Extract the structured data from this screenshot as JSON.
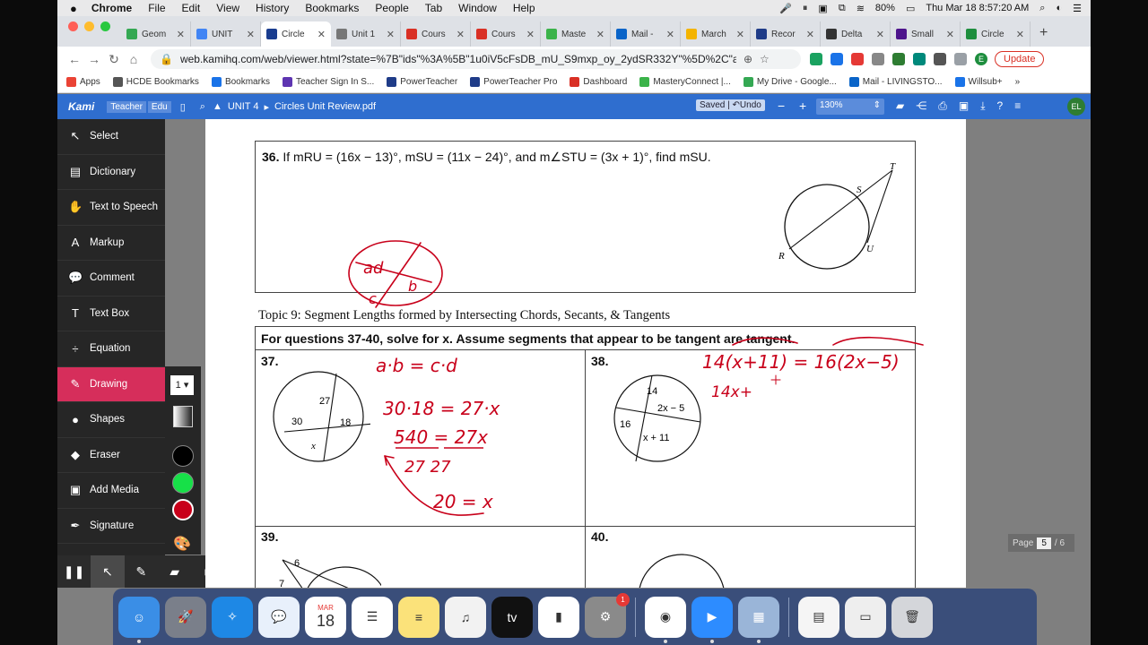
{
  "menubar": {
    "app_name": "Chrome",
    "items": [
      "File",
      "Edit",
      "View",
      "History",
      "Bookmarks",
      "People",
      "Tab",
      "Window",
      "Help"
    ],
    "battery": "80%",
    "datetime": "Thu Mar 18  8:57:20 AM"
  },
  "tabs": [
    {
      "label": "Geom",
      "color": "#34a853"
    },
    {
      "label": "UNIT",
      "color": "#4285f4"
    },
    {
      "label": "Circle",
      "color": "#1a3d8f",
      "active": true
    },
    {
      "label": "Unit 1",
      "color": "#777777"
    },
    {
      "label": "Cours",
      "color": "#d93025"
    },
    {
      "label": "Cours",
      "color": "#d93025"
    },
    {
      "label": "Maste",
      "color": "#3bb34a"
    },
    {
      "label": "Mail -",
      "color": "#0a64c8"
    },
    {
      "label": "March",
      "color": "#f4b400"
    },
    {
      "label": "Recor",
      "color": "#1f3c88"
    },
    {
      "label": "Delta",
      "color": "#333333"
    },
    {
      "label": "Small",
      "color": "#4d148c"
    },
    {
      "label": "Circle",
      "color": "#1e8e3e"
    }
  ],
  "address": {
    "url": "web.kamihq.com/web/viewer.html?state=%7B\"ids\"%3A%5B\"1u0iV5cFsDB_mU_S9mxp_oy_2ydSR332Y\"%5D%2C\"a...",
    "update_label": "Update",
    "profile": "E"
  },
  "bookmarks": [
    {
      "label": "Apps",
      "color": "#ea4335"
    },
    {
      "label": "HCDE Bookmarks",
      "color": "#555555"
    },
    {
      "label": "Bookmarks",
      "color": "#1a73e8"
    },
    {
      "label": "Teacher Sign In S...",
      "color": "#5e35b1"
    },
    {
      "label": "PowerTeacher",
      "color": "#1f3c88"
    },
    {
      "label": "PowerTeacher Pro",
      "color": "#1f3c88"
    },
    {
      "label": "Dashboard",
      "color": "#d93025"
    },
    {
      "label": "MasteryConnect |...",
      "color": "#3bb34a"
    },
    {
      "label": "My Drive - Google...",
      "color": "#34a853"
    },
    {
      "label": "Mail - LIVINGSTO...",
      "color": "#0a64c8"
    },
    {
      "label": "Willsub+",
      "color": "#1a73e8"
    }
  ],
  "bookmarks_more": "»",
  "kami": {
    "logo": "Kami",
    "badge_teacher": "Teacher",
    "badge_edu": "Edu",
    "folder": "UNIT 4",
    "file": "Circles Unit Review.pdf",
    "saved": "Saved",
    "undo": "Undo",
    "zoom": "130%",
    "avatar": "EL"
  },
  "sidebar": {
    "items": [
      {
        "label": "Select",
        "icon": "cursor-icon",
        "glyph": "↖"
      },
      {
        "label": "Dictionary",
        "icon": "book-icon",
        "glyph": "▤"
      },
      {
        "label": "Text to Speech",
        "icon": "speech-icon",
        "glyph": "✋"
      },
      {
        "label": "Markup",
        "icon": "markup-icon",
        "glyph": "A"
      },
      {
        "label": "Comment",
        "icon": "comment-icon",
        "glyph": "💬"
      },
      {
        "label": "Text Box",
        "icon": "textbox-icon",
        "glyph": "T"
      },
      {
        "label": "Equation",
        "icon": "equation-icon",
        "glyph": "÷"
      },
      {
        "label": "Drawing",
        "icon": "pencil-icon",
        "glyph": "✎",
        "active": true
      },
      {
        "label": "Shapes",
        "icon": "shapes-icon",
        "glyph": "●"
      },
      {
        "label": "Eraser",
        "icon": "eraser-icon",
        "glyph": "◆"
      },
      {
        "label": "Add Media",
        "icon": "media-icon",
        "glyph": "▣"
      },
      {
        "label": "Signature",
        "icon": "signature-icon",
        "glyph": "✒"
      }
    ]
  },
  "palette": {
    "size": "1",
    "colors": [
      "#000000",
      "#17e048",
      "#c8001a"
    ]
  },
  "document": {
    "q36_number": "36.",
    "q36_text": "If mRU = (16x − 13)°,  mSU = (11x − 24)°, and m∠STU = (3x + 1)°, find  mSU.",
    "q36_labels": {
      "T": "T",
      "S": "S",
      "R": "R",
      "U": "U"
    },
    "topic": "Topic 9: Segment Lengths formed by Intersecting Chords, Secants, & Tangents",
    "instructions": "For questions 37-40, solve for x.  Assume segments that appear to be tangent are tangent.",
    "q37_number": "37.",
    "q38_number": "38.",
    "q39_number": "39.",
    "q40_number": "40.",
    "q37_labels": {
      "a": "27",
      "b": "30",
      "c": "18",
      "d": "x"
    },
    "q38_labels": {
      "a": "14",
      "b": "16",
      "c": "2x − 5",
      "d": "x + 11"
    },
    "q39_labels": {
      "a": "6",
      "b": "7"
    },
    "ink": {
      "ad": "ad",
      "c": "c",
      "b": "b",
      "abcd": "a·b = c·d",
      "step1": "30·18 = 27·x",
      "step2": "540 = 27x",
      "div": "27      27",
      "ans": "20 = x",
      "q38a": "14(x+11) = 16(2x−5)",
      "q38b": "14x+"
    }
  },
  "pager": {
    "label": "Page",
    "current": "5",
    "total": "/ 6"
  },
  "dock": {
    "apps": [
      {
        "name": "finder",
        "color": "#3a8ee6",
        "glyph": "☺"
      },
      {
        "name": "launchpad",
        "color": "#7a7f8a",
        "glyph": "🚀"
      },
      {
        "name": "safari",
        "color": "#1e88e5",
        "glyph": "✧"
      },
      {
        "name": "messages",
        "color": "#e8f0fb",
        "glyph": "💬"
      },
      {
        "name": "calendar",
        "color": "#ffffff",
        "glyph": "18"
      },
      {
        "name": "reminders",
        "color": "#ffffff",
        "glyph": "☰"
      },
      {
        "name": "notes",
        "color": "#fbe27a",
        "glyph": "≡"
      },
      {
        "name": "music",
        "color": "#f2f2f2",
        "glyph": "♫"
      },
      {
        "name": "tv",
        "color": "#111111",
        "glyph": "tv"
      },
      {
        "name": "numbers",
        "color": "#ffffff",
        "glyph": "▮"
      },
      {
        "name": "system-preferences",
        "color": "#8a8a8a",
        "glyph": "⚙"
      },
      {
        "name": "chrome",
        "color": "#ffffff",
        "glyph": "◉"
      },
      {
        "name": "zoom",
        "color": "#2d8cff",
        "glyph": "▶"
      },
      {
        "name": "preview",
        "color": "#9ab5d8",
        "glyph": "▦"
      },
      {
        "name": "document",
        "color": "#f5f5f5",
        "glyph": "▤"
      },
      {
        "name": "screenshot",
        "color": "#eeeeee",
        "glyph": "▭"
      },
      {
        "name": "trash",
        "color": "#d4d6da",
        "glyph": "🗑"
      }
    ],
    "calendar_month": "MAR",
    "calendar_day": "18",
    "sysprefs_badge": "1"
  }
}
